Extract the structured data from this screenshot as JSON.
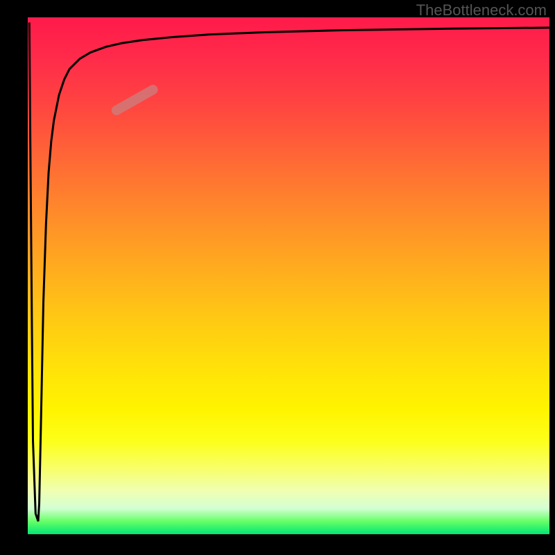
{
  "watermark": "TheBottleneck.com",
  "chart_data": {
    "type": "line",
    "title": "",
    "xlabel": "",
    "ylabel": "",
    "xlim": [
      0,
      100
    ],
    "ylim": [
      0,
      100
    ],
    "gradient_background": {
      "direction": "vertical",
      "colors": [
        {
          "stop": 0,
          "color": "#ff1a4a"
        },
        {
          "stop": 0.35,
          "color": "#ff8b2a"
        },
        {
          "stop": 0.7,
          "color": "#fff400"
        },
        {
          "stop": 0.92,
          "color": "#f0ffb0"
        },
        {
          "stop": 1.0,
          "color": "#00e676"
        }
      ]
    },
    "series": [
      {
        "name": "main-curve",
        "color": "#000000",
        "x": [
          0.3,
          0.5,
          0.8,
          1.0,
          1.5,
          2.0,
          2.2,
          2.5,
          3.0,
          3.5,
          4.0,
          4.5,
          5.0,
          6.0,
          7.0,
          8.0,
          10.0,
          12.0,
          15.0,
          18.0,
          22.0,
          28.0,
          35.0,
          45.0,
          60.0,
          80.0,
          100.0
        ],
        "y": [
          99.0,
          75.0,
          40.0,
          18.0,
          4.0,
          2.5,
          6.0,
          20.0,
          45.0,
          60.0,
          70.0,
          76.0,
          80.0,
          85.0,
          88.0,
          90.0,
          92.0,
          93.2,
          94.3,
          95.0,
          95.6,
          96.2,
          96.7,
          97.1,
          97.5,
          97.8,
          98.0
        ]
      },
      {
        "name": "highlight-segment",
        "color": "#c98080",
        "thickness": "thick",
        "x": [
          17.0,
          24.0
        ],
        "y": [
          82.0,
          86.0
        ]
      }
    ]
  }
}
